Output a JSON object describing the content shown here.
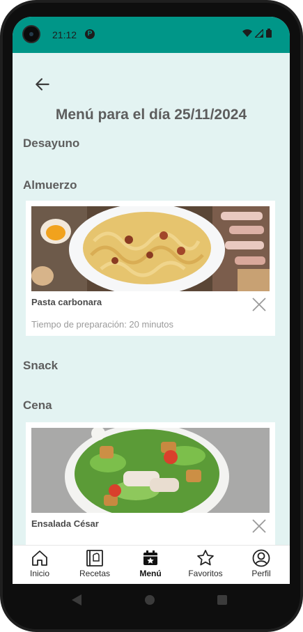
{
  "status": {
    "time": "21:12",
    "app_icon_letter": "P"
  },
  "page": {
    "title": "Menú para el día 25/11/2024"
  },
  "sections": {
    "desayuno": "Desayuno",
    "almuerzo": "Almuerzo",
    "snack": "Snack",
    "cena": "Cena"
  },
  "meals": {
    "almuerzo": {
      "name": "Pasta carbonara",
      "time": "Tiempo de preparación: 20 minutos"
    },
    "cena": {
      "name": "Ensalada César"
    }
  },
  "nav": {
    "items": [
      {
        "label": "Inicio",
        "icon": "home-icon"
      },
      {
        "label": "Recetas",
        "icon": "recipe-book-icon"
      },
      {
        "label": "Menú",
        "icon": "calendar-icon",
        "active": true
      },
      {
        "label": "Favoritos",
        "icon": "star-icon"
      },
      {
        "label": "Perfil",
        "icon": "profile-icon"
      }
    ]
  },
  "colors": {
    "accent": "#009688",
    "background": "#e3f3f2",
    "heading": "#5d5d5d"
  }
}
